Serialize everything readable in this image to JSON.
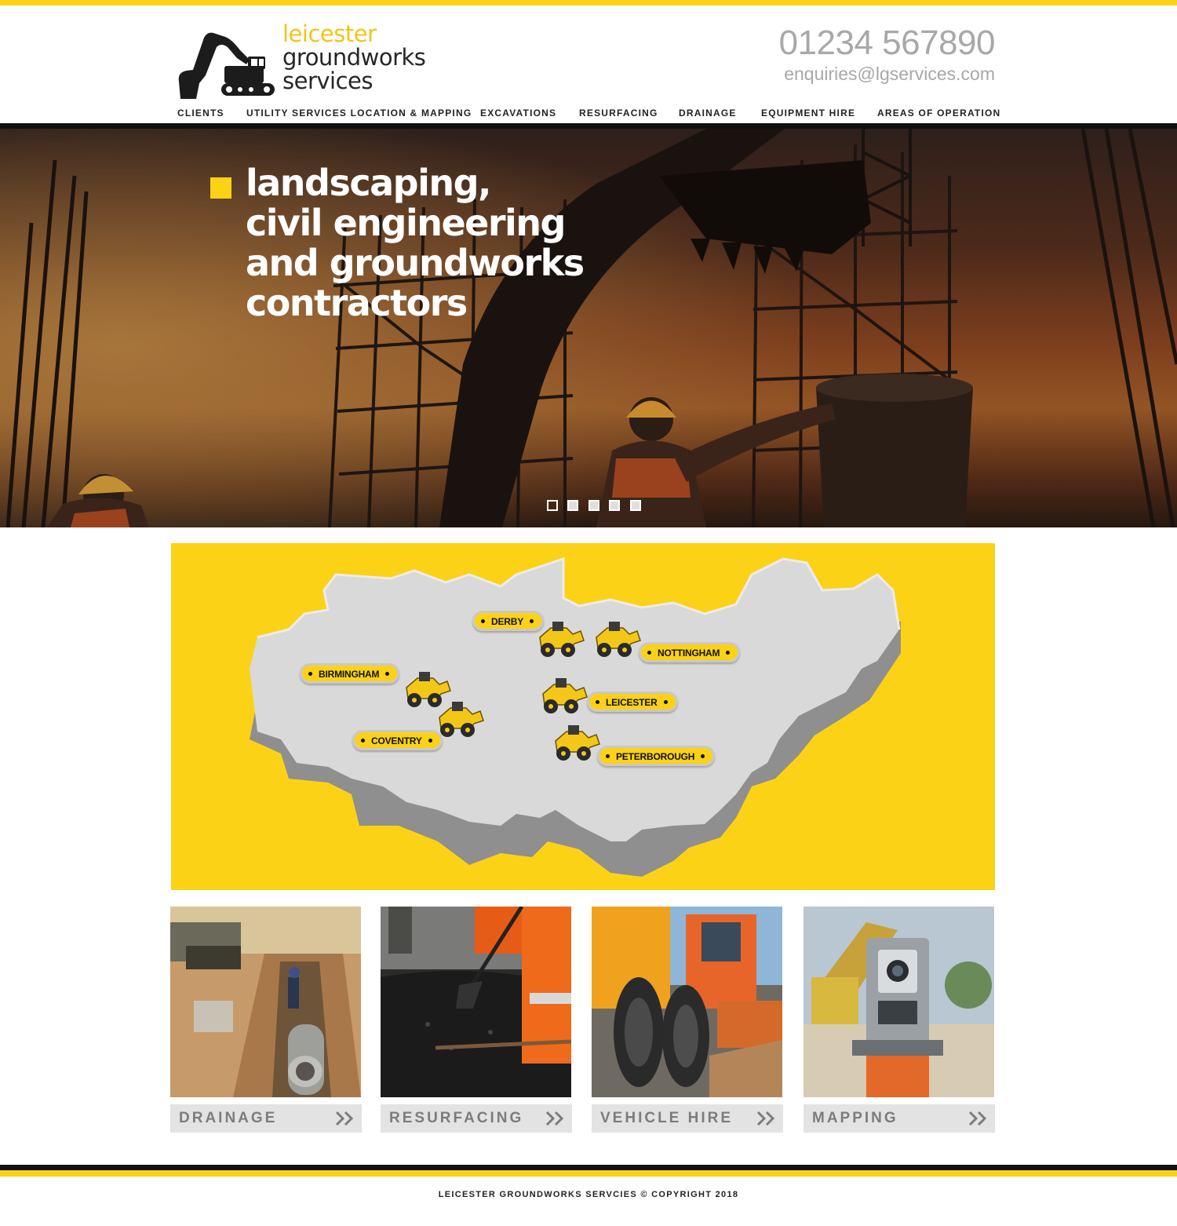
{
  "brand": {
    "line1": "leicester",
    "line2": "groundworks",
    "line3": "services",
    "accent": "#fcd217",
    "logo_icon": "excavator-icon"
  },
  "contact": {
    "phone": "01234 567890",
    "email": "enquiries@lgservices.com"
  },
  "nav": {
    "items": [
      {
        "label": "CLIENTS"
      },
      {
        "label": "UTILITY SERVICES LOCATION & MAPPING"
      },
      {
        "label": "EXCAVATIONS"
      },
      {
        "label": "RESURFACING"
      },
      {
        "label": "DRAINAGE"
      },
      {
        "label": "EQUIPMENT HIRE"
      },
      {
        "label": "AREAS OF OPERATION"
      }
    ],
    "active": "EXCAVATIONS"
  },
  "hero": {
    "lines": [
      "landscaping,",
      "civil engineering",
      "and groundworks",
      "contractors"
    ],
    "slide_count": 5,
    "active_slide": 1
  },
  "map": {
    "locations": [
      {
        "name": "DERBY"
      },
      {
        "name": "NOTTINGHAM"
      },
      {
        "name": "BIRMINGHAM"
      },
      {
        "name": "LEICESTER"
      },
      {
        "name": "COVENTRY"
      },
      {
        "name": "PETERBOROUGH"
      }
    ],
    "vehicle_icon": "wheel-loader-icon"
  },
  "services": [
    {
      "label": "DRAINAGE",
      "icon": "double-chevron-right-icon"
    },
    {
      "label": "RESURFACING",
      "icon": "double-chevron-right-icon"
    },
    {
      "label": "VEHICLE HIRE",
      "icon": "double-chevron-right-icon"
    },
    {
      "label": "MAPPING",
      "icon": "double-chevron-right-icon"
    }
  ],
  "footer": {
    "copyright": "LEICESTER GROUNDWORKS SERVCIES © COPYRIGHT 2018"
  }
}
